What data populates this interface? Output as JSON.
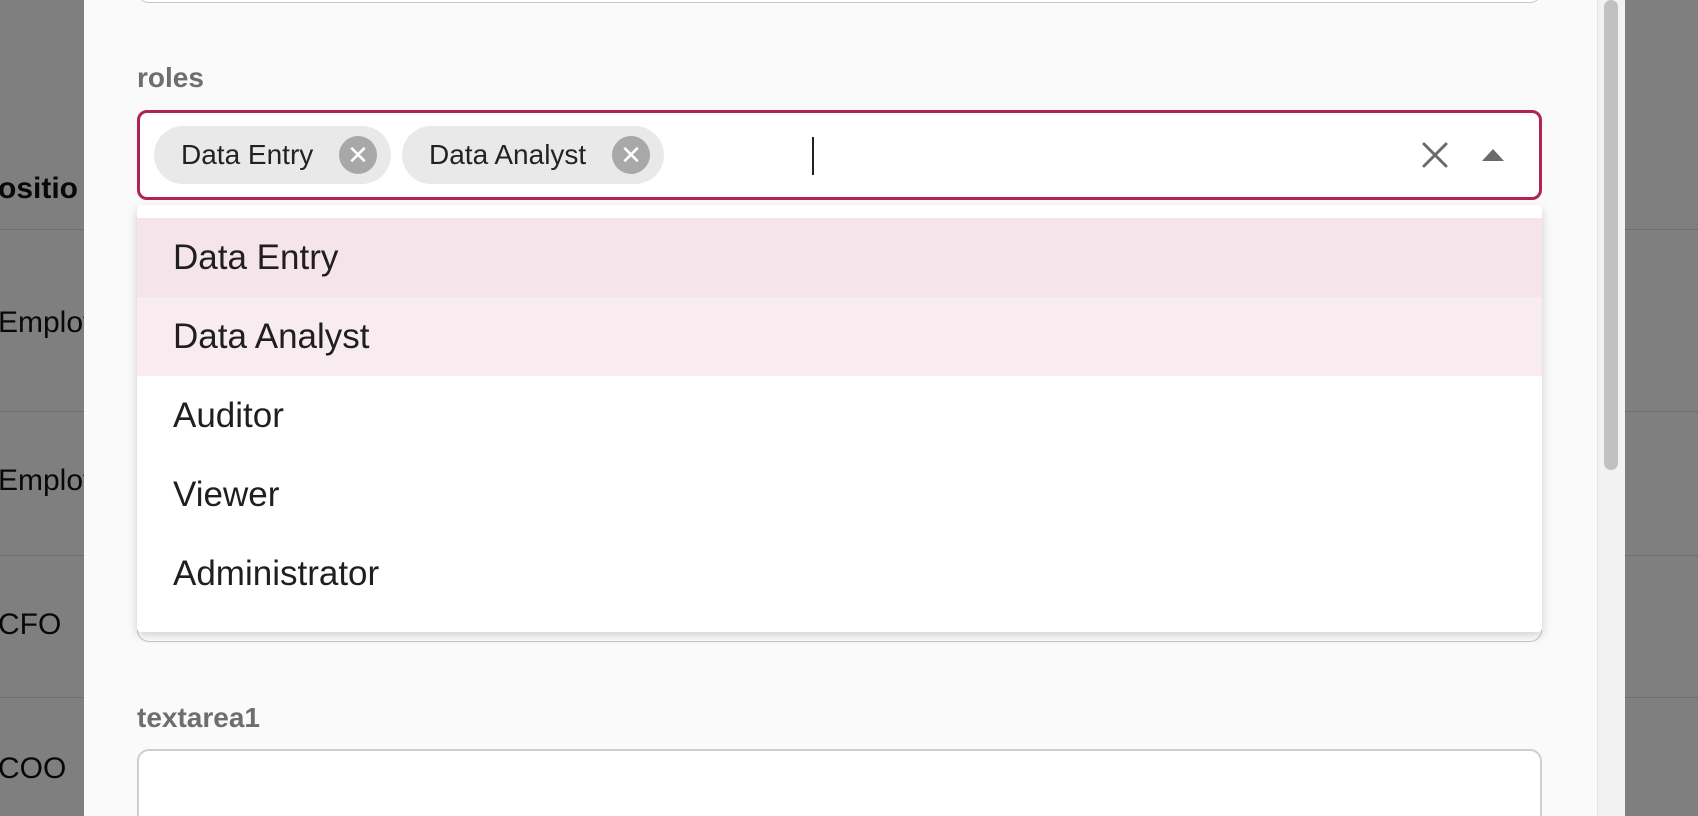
{
  "background_table": {
    "header": "ositio",
    "rows": [
      "Employ",
      "Employ",
      "CFO",
      "COO"
    ]
  },
  "form": {
    "roles_label": "roles",
    "selected_chips": [
      "Data Entry",
      "Data Analyst"
    ],
    "options": [
      "Data Entry",
      "Data Analyst",
      "Auditor",
      "Viewer",
      "Administrator"
    ],
    "textarea_label": "textarea1"
  },
  "colors": {
    "accent": "#b0235a",
    "option_selected": "#f8ecf0",
    "option_focused": "#f5e4ea"
  },
  "icons": {
    "chip_remove": "circle-x-icon",
    "clear": "close-icon",
    "toggle": "caret-up-icon"
  }
}
